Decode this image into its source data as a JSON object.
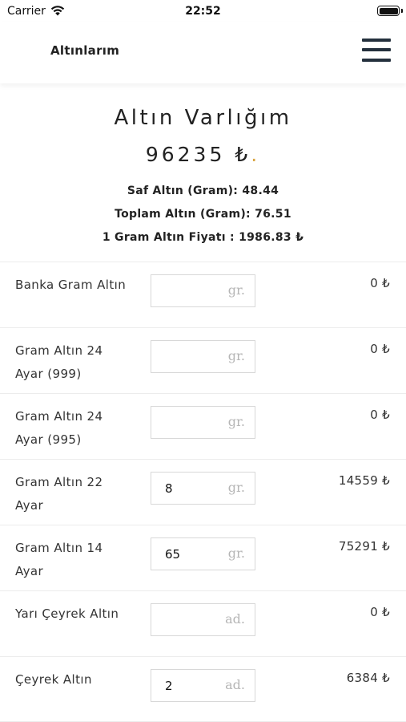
{
  "status": {
    "carrier": "Carrier",
    "time": "22:52"
  },
  "nav": {
    "title": "Altınlarım",
    "menu_icon": "hamburger-menu-icon"
  },
  "summary": {
    "title": "Altın Varlığım",
    "total": "96235 ₺",
    "total_dot": ".",
    "saf_altin": "Saf Altın (Gram): 48.44",
    "toplam_altin": "Toplam Altın (Gram): 76.51",
    "gram_fiyati": "1 Gram Altın Fiyatı : 1986.83 ₺"
  },
  "rows": [
    {
      "label": "Banka Gram Altın",
      "value": "",
      "unit": "gr.",
      "amount": "0 ₺"
    },
    {
      "label": "Gram Altın 24 Ayar (999)",
      "value": "",
      "unit": "gr.",
      "amount": "0 ₺"
    },
    {
      "label": "Gram Altın 24 Ayar (995)",
      "value": "",
      "unit": "gr.",
      "amount": "0 ₺"
    },
    {
      "label": "Gram Altın 22 Ayar",
      "value": "8",
      "unit": "gr.",
      "amount": "14559 ₺"
    },
    {
      "label": "Gram Altın 14 Ayar",
      "value": "65",
      "unit": "gr.",
      "amount": "75291 ₺"
    },
    {
      "label": "Yarı Çeyrek Altın",
      "value": "",
      "unit": "ad.",
      "amount": "0 ₺"
    },
    {
      "label": "Çeyrek Altın",
      "value": "2",
      "unit": "ad.",
      "amount": "6384 ₺"
    }
  ],
  "colors": {
    "accent_dot": "#d9a441",
    "menu_icon": "#24303d"
  }
}
